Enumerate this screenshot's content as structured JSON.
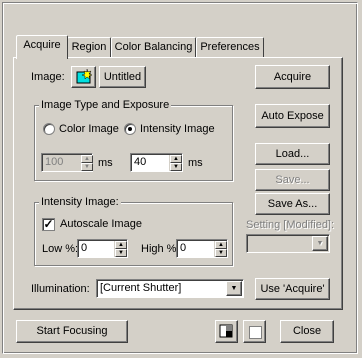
{
  "tabs": [
    {
      "label": "Acquire",
      "active": true
    },
    {
      "label": "Region",
      "active": false
    },
    {
      "label": "Color Balancing",
      "active": false
    },
    {
      "label": "Preferences",
      "active": false
    }
  ],
  "image": {
    "label": "Image:",
    "name_button": "Untitled",
    "icon": "new-image-icon"
  },
  "exposure_group": {
    "title": "Image Type and Exposure",
    "radio_color": "Color Image",
    "radio_intensity": "Intensity Image",
    "selected": "intensity",
    "color_exposure_value": "100",
    "color_exposure_unit": "ms",
    "intensity_exposure_value": "40",
    "intensity_exposure_unit": "ms"
  },
  "intensity_group": {
    "title": "Intensity Image:",
    "autoscale_label": "Autoscale Image",
    "autoscale_checked": true,
    "low_label": "Low %:",
    "low_value": "0",
    "high_label": "High %:",
    "high_value": "0"
  },
  "right_buttons": {
    "acquire": "Acquire",
    "auto_expose": "Auto Expose",
    "load": "Load...",
    "save": "Save...",
    "save_as": "Save As...",
    "setting_label": "Setting [Modified]:"
  },
  "illumination": {
    "label": "Illumination:",
    "value": "[Current Shutter]",
    "use_acquire": "Use 'Acquire'"
  },
  "bottom": {
    "start_focusing": "Start Focusing",
    "close": "Close"
  },
  "colors": {
    "face": "#d4d0c8",
    "icon_cyan": "#00e0e0"
  }
}
